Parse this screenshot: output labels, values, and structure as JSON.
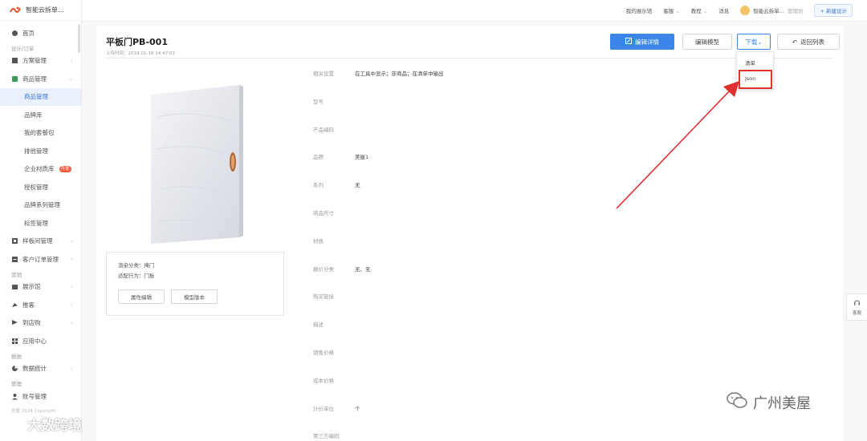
{
  "app": {
    "title": "智能云拆单..."
  },
  "topbar": {
    "items": [
      "我的展示馆",
      "客服",
      "教程",
      "消息"
    ],
    "user_name": "智能云拆单...",
    "role": "管理员",
    "new_design": "+ 新建设计"
  },
  "sidebar": {
    "home": "首页",
    "section_design": "设计/订单",
    "scheme": "方案管理",
    "goods": "商品管理",
    "goods_sub": [
      "商品管理",
      "品牌库",
      "我的套餐包",
      "排他管理",
      "企业材质库",
      "授权管理",
      "品牌系列管理",
      "标签管理"
    ],
    "badge": "开发",
    "sample": "样板间管理",
    "orders": "客户订单管理",
    "section_marketing": "营销",
    "showroom": "展示馆",
    "promote": "推客",
    "shop": "到店购",
    "apps": "应用中心",
    "section_data": "数据",
    "stats": "数据统计",
    "section_manage": "管理",
    "accounts": "账号管理",
    "footer": "全屋 2024 Copyright"
  },
  "page": {
    "title": "平板门PB-001",
    "upload_time": "上传时间：2019-01-18 14:47:03"
  },
  "actions": {
    "edit_detail": "编辑详情",
    "edit_model": "编辑模型",
    "download": "下载",
    "back_to_list": "返回列表"
  },
  "dropdown": {
    "items": [
      "清单",
      "Json"
    ]
  },
  "product": {
    "render_category": "渲染分类：掩门",
    "fit_behavior": "适配行为：门板",
    "btn_attr_edit": "属性编辑",
    "btn_model_version": "模型版本"
  },
  "properties": [
    {
      "label": "相关设置",
      "value": "在工具中显示；非商品；在清单中输出"
    },
    {
      "label": "型号",
      "value": ""
    },
    {
      "label": "产品编码",
      "value": ""
    },
    {
      "label": "品牌",
      "value": "美屋1"
    },
    {
      "label": "系列",
      "value": "无"
    },
    {
      "label": "商品尺寸",
      "value": ""
    },
    {
      "label": "材质",
      "value": ""
    },
    {
      "label": "报价分类",
      "value": "无、无"
    },
    {
      "label": "购买链接",
      "value": ""
    },
    {
      "label": "描述",
      "value": ""
    },
    {
      "label": "销售价格",
      "value": ""
    },
    {
      "label": "成本价格",
      "value": ""
    },
    {
      "label": "计价单位",
      "value": "个"
    },
    {
      "label": "第三方编码",
      "value": ""
    }
  ],
  "float_service": {
    "label": "客服"
  },
  "watermarks": {
    "left": "大数跨境",
    "right": "广州美屋"
  },
  "colors": {
    "primary": "#3a86e8",
    "highlight": "#e03030",
    "active_bg": "#eaf1fd"
  }
}
